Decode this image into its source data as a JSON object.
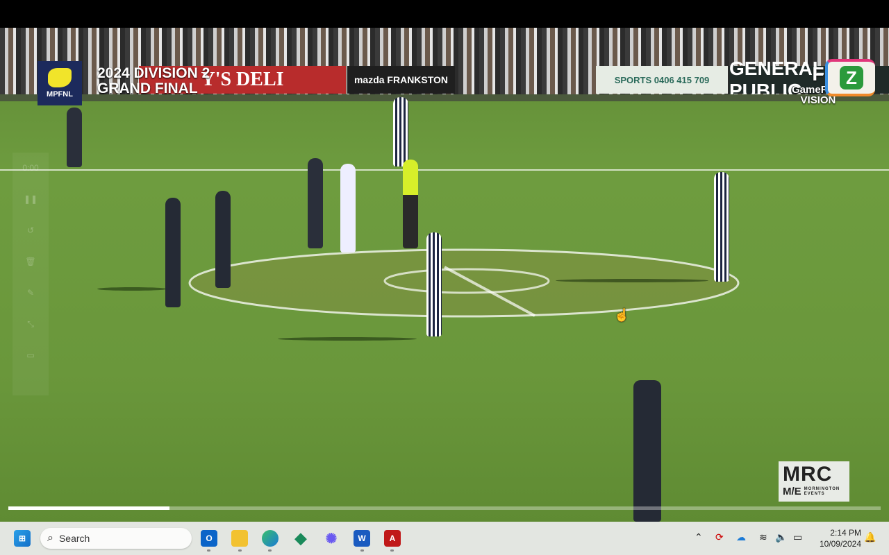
{
  "overlay": {
    "league_logo_text": "MPFNL",
    "title_line1": "2024 DIVISION 2",
    "title_line2": "GRAND FINAL",
    "broadcaster_line1": "GameFace",
    "broadcaster_line2": "VISION",
    "corner_logo": "Z",
    "sponsor_logo_big": "MRC",
    "sponsor_logo_small": "M/E",
    "sponsor_logo_sub1": "MORNINGTON",
    "sponsor_logo_sub2": "EVENTS"
  },
  "boards": [
    "Y'S DELI",
    "mazda FRANKSTON",
    "SPORTS 0406 415 709",
    "GENERAL PUBLIC"
  ],
  "recorder": {
    "time": "0:00",
    "icons": [
      "pause-icon",
      "undo-icon",
      "delete-icon",
      "pen-icon",
      "hide-icon",
      "camera-icon"
    ]
  },
  "player": {
    "progress_percent": 18.5
  },
  "taskbar": {
    "search_placeholder": "Search",
    "apps": [
      "outlook",
      "file-explorer",
      "edge",
      "ethereum",
      "copilot",
      "word",
      "acrobat"
    ],
    "time": "2:14 PM",
    "date": "10/09/2024"
  },
  "colors": {
    "field": "#6a973b",
    "taskbar": "#e3e6e1",
    "league": "#1c2a5c"
  }
}
